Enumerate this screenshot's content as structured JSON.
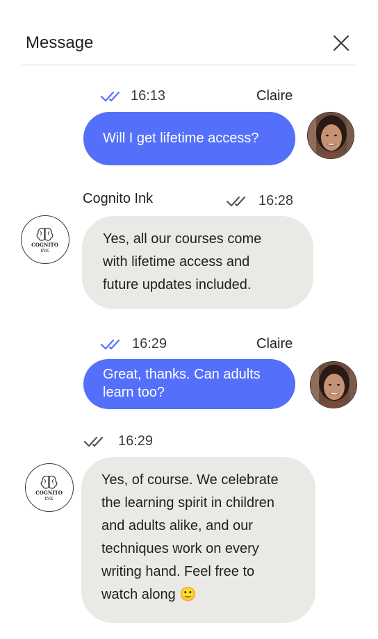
{
  "header": {
    "title": "Message"
  },
  "messages": [
    {
      "time": "16:13",
      "sender": "Claire",
      "text": "Will I get lifetime access?"
    },
    {
      "time": "16:28",
      "sender": "Cognito Ink",
      "text_lines": [
        "Yes, all our courses come",
        "with lifetime access and",
        "future updates included."
      ]
    },
    {
      "time": "16:29",
      "sender": "Claire",
      "text_lines": [
        "Great, thanks. Can adults",
        "learn too?"
      ]
    },
    {
      "time": "16:29",
      "text_lines": [
        "Yes, of course. We celebrate",
        "the learning spirit in children",
        "and adults alike, and our",
        "techniques work on every",
        "writing hand. Feel free to",
        "watch along 🙂"
      ]
    }
  ],
  "logo": {
    "line1": "COGNITO",
    "line2": "INK"
  },
  "colors": {
    "outgoing_bubble": "#5470fb",
    "incoming_bubble": "#ebe9e6",
    "read_ticks_blue": "#5470fb",
    "read_ticks_gray": "#555555"
  }
}
